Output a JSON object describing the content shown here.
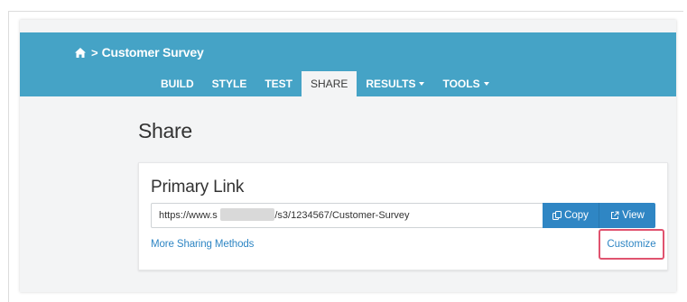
{
  "header": {
    "breadcrumb_separator": ">",
    "survey_title": "Customer Survey"
  },
  "tabs": [
    {
      "label": "BUILD",
      "active": false,
      "dropdown": false
    },
    {
      "label": "STYLE",
      "active": false,
      "dropdown": false
    },
    {
      "label": "TEST",
      "active": false,
      "dropdown": false
    },
    {
      "label": "SHARE",
      "active": true,
      "dropdown": false
    },
    {
      "label": "RESULTS",
      "active": false,
      "dropdown": true
    },
    {
      "label": "TOOLS",
      "active": false,
      "dropdown": true
    }
  ],
  "page": {
    "title": "Share"
  },
  "primary_link": {
    "title": "Primary Link",
    "url_value": "https://www.s             .com/s3/1234567/Customer-Survey",
    "copy_label": "Copy",
    "view_label": "View",
    "more_sharing_label": "More Sharing Methods",
    "customize_label": "Customize"
  },
  "colors": {
    "header_bg": "#45a3c6",
    "button_bg": "#2f86c4",
    "link": "#2f86c4",
    "highlight": "#e0536f"
  },
  "icons": {
    "home": "home-icon",
    "copy": "copy-icon",
    "view": "external-link-icon",
    "caret": "caret-down-icon"
  }
}
